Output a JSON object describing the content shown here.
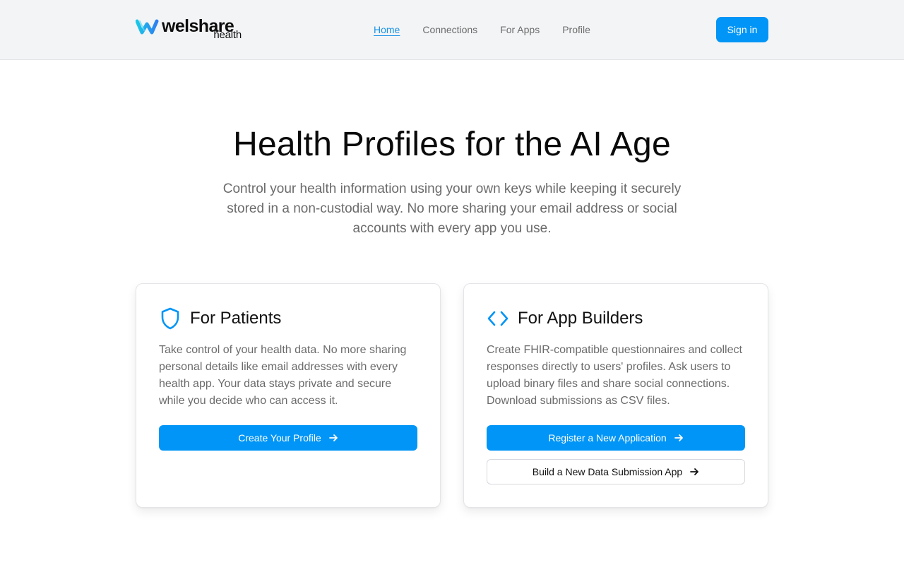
{
  "header": {
    "logo": {
      "word": "welshare",
      "sub": "health"
    },
    "nav": [
      {
        "label": "Home",
        "active": true
      },
      {
        "label": "Connections",
        "active": false
      },
      {
        "label": "For Apps",
        "active": false
      },
      {
        "label": "Profile",
        "active": false
      }
    ],
    "signin_label": "Sign in"
  },
  "hero": {
    "title": "Health Profiles for the AI Age",
    "subtitle": "Control your health information using your own keys while keeping it securely stored in a non-custodial way. No more sharing your email address or social accounts with every app you use."
  },
  "cards": {
    "patients": {
      "icon": "shield-icon",
      "title": "For Patients",
      "text": "Take control of your health data. No more sharing personal details like email addresses with every health app. Your data stays private and secure while you decide who can access it.",
      "primary_button": "Create Your Profile"
    },
    "builders": {
      "icon": "code-icon",
      "title": "For App Builders",
      "text": "Create FHIR-compatible questionnaires and collect responses directly to users' profiles. Ask users to upload binary files and share social connections. Download submissions as CSV files.",
      "primary_button": "Register a New Application",
      "secondary_button": "Build a New Data Submission App"
    }
  },
  "colors": {
    "accent": "#0095f6",
    "link_active": "#1a93e6",
    "muted_text": "#6b6b6b",
    "header_bg": "#f3f4f6"
  }
}
